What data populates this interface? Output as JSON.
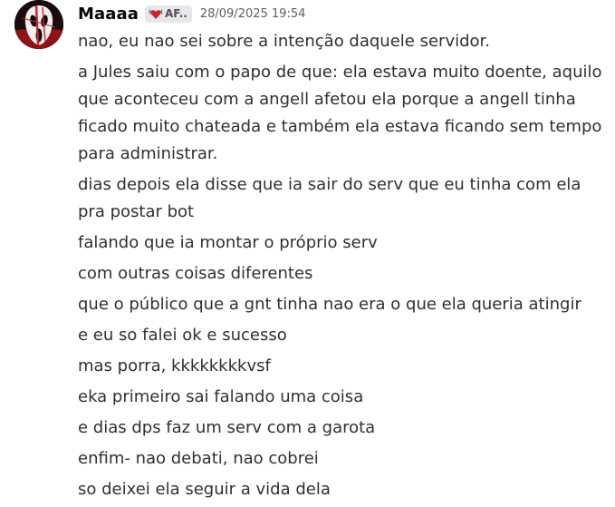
{
  "author": {
    "username": "Maaaa",
    "tag": "AF..",
    "timestamp": "28/09/2025 19:54",
    "avatar_icon": "ghostface-mask-icon",
    "tag_icon": "winged-heart-icon"
  },
  "messages": [
    "nao, eu nao sei sobre a intenção daquele servidor.",
    "a Jules saiu com o papo de que: ela estava muito doente, aquilo que aconteceu com a angell afetou ela porque a angell tinha ficado muito chateada e também ela estava ficando sem tempo para administrar.",
    "dias depois ela disse que ia sair do serv que eu tinha com ela pra postar bot",
    "falando que ia montar o próprio serv",
    "com outras coisas diferentes",
    "que o público que a gnt tinha nao era o que ela queria atingir",
    "e eu so falei ok e sucesso",
    "mas porra, kkkkkkkkvsf",
    "eka primeiro sai falando uma coisa",
    "e dias dps faz um serv com a garota",
    "enfim- nao debati, nao cobrei",
    "so deixei ela seguir a vida dela"
  ],
  "colors": {
    "username": "#060607",
    "text": "#2e3035",
    "timestamp": "#5c5e66",
    "tag_bg": "#e6e7ea",
    "accent_red": "#d1222b"
  }
}
